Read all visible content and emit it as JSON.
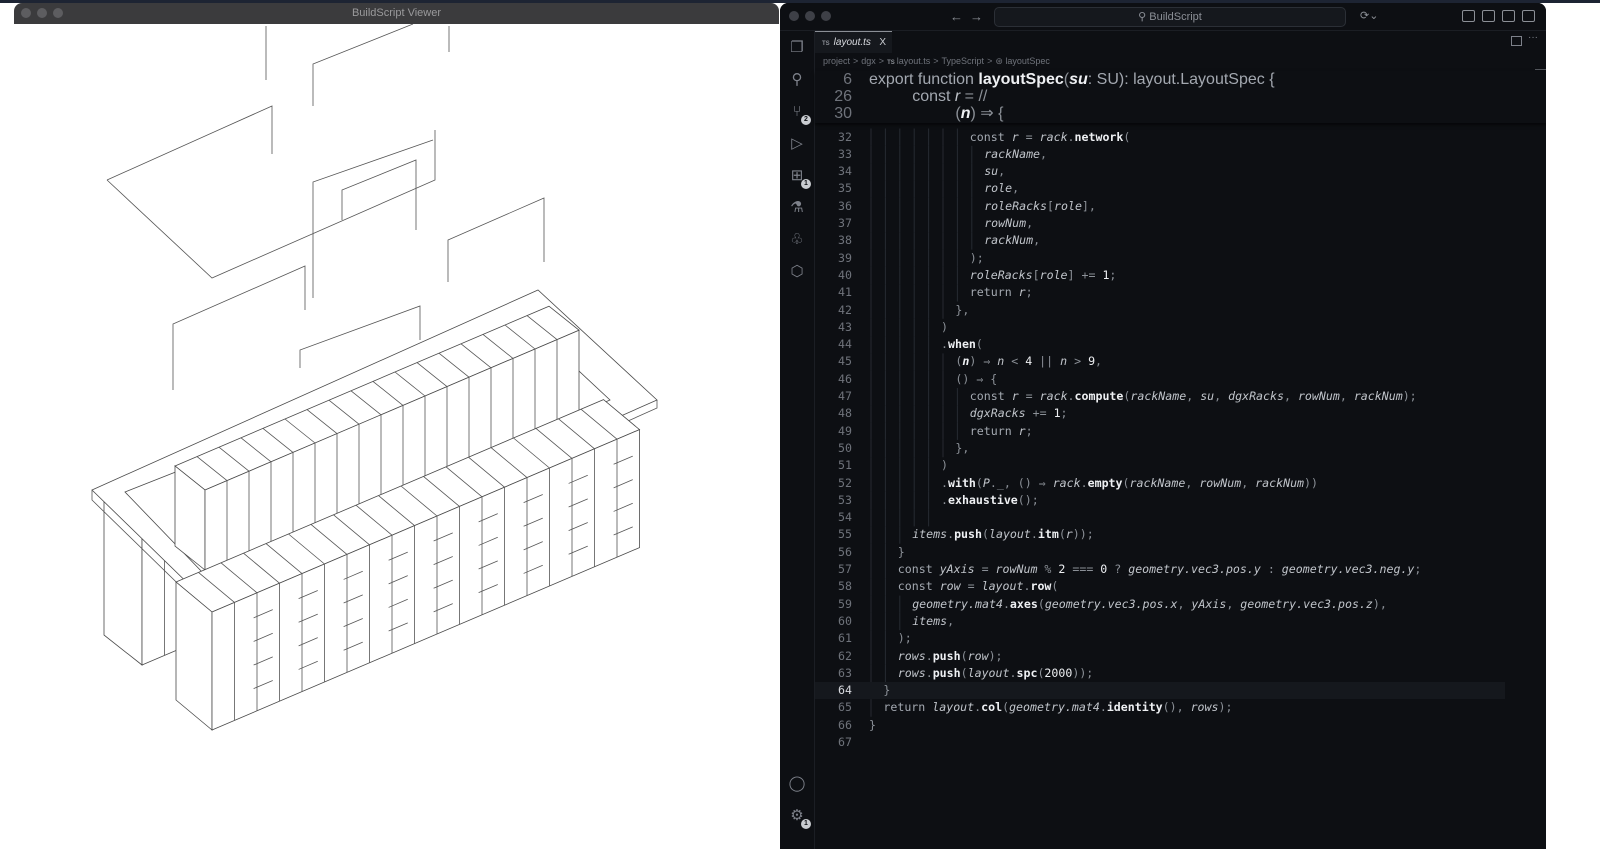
{
  "viewer": {
    "title": "BuildScript Viewer"
  },
  "editor": {
    "search": "BuildScript",
    "nav_back": "←",
    "nav_forward": "→",
    "tab": {
      "lang": "TS",
      "name": "layout.ts",
      "close": "X"
    },
    "more": "···",
    "breadcrumbs": [
      "project",
      "dgx",
      "layout.ts",
      "TypeScript",
      "layoutSpec"
    ],
    "breadcrumb_sep": ">",
    "activity_badges": {
      "source_control": "2",
      "extensions": "1",
      "settings": "1"
    }
  },
  "sticky": [
    {
      "n": "6",
      "indent": 0,
      "tokens": [
        [
          "export function ",
          "k"
        ],
        [
          "layoutSpec",
          "f"
        ],
        [
          "(",
          "p"
        ],
        [
          "su",
          "vb"
        ],
        [
          ": SU): layout.LayoutSpec {",
          "k"
        ]
      ]
    },
    {
      "n": "26",
      "indent": 6,
      "tokens": [
        [
          "const ",
          "k"
        ],
        [
          "r",
          "v"
        ],
        [
          " = //",
          "p"
        ]
      ]
    },
    {
      "n": "30",
      "indent": 12,
      "tokens": [
        [
          "(",
          "p"
        ],
        [
          "n",
          "vb"
        ],
        [
          ") ⇒ {",
          "p"
        ]
      ]
    }
  ],
  "code": {
    "current_line": "64",
    "lines": [
      {
        "n": "32",
        "indent": 14,
        "tokens": [
          [
            "const ",
            "k"
          ],
          [
            "r",
            "v"
          ],
          [
            " = ",
            "p"
          ],
          [
            "rack",
            "v"
          ],
          [
            ".",
            "p"
          ],
          [
            "network",
            "f"
          ],
          [
            "(",
            "p"
          ]
        ]
      },
      {
        "n": "33",
        "indent": 16,
        "tokens": [
          [
            "rackName",
            "v"
          ],
          [
            ",",
            "p"
          ]
        ]
      },
      {
        "n": "34",
        "indent": 16,
        "tokens": [
          [
            "su",
            "v"
          ],
          [
            ",",
            "p"
          ]
        ]
      },
      {
        "n": "35",
        "indent": 16,
        "tokens": [
          [
            "role",
            "v"
          ],
          [
            ",",
            "p"
          ]
        ]
      },
      {
        "n": "36",
        "indent": 16,
        "tokens": [
          [
            "roleRacks",
            "v"
          ],
          [
            "[",
            "p"
          ],
          [
            "role",
            "v"
          ],
          [
            "],",
            "p"
          ]
        ]
      },
      {
        "n": "37",
        "indent": 16,
        "tokens": [
          [
            "rowNum",
            "v"
          ],
          [
            ",",
            "p"
          ]
        ]
      },
      {
        "n": "38",
        "indent": 16,
        "tokens": [
          [
            "rackNum",
            "v"
          ],
          [
            ",",
            "p"
          ]
        ]
      },
      {
        "n": "39",
        "indent": 14,
        "tokens": [
          [
            ");",
            "p"
          ]
        ]
      },
      {
        "n": "40",
        "indent": 14,
        "tokens": [
          [
            "roleRacks",
            "v"
          ],
          [
            "[",
            "p"
          ],
          [
            "role",
            "v"
          ],
          [
            "] += ",
            "p"
          ],
          [
            "1",
            "n"
          ],
          [
            ";",
            "p"
          ]
        ]
      },
      {
        "n": "41",
        "indent": 14,
        "tokens": [
          [
            "return ",
            "k"
          ],
          [
            "r",
            "v"
          ],
          [
            ";",
            "p"
          ]
        ]
      },
      {
        "n": "42",
        "indent": 12,
        "tokens": [
          [
            "},",
            "p"
          ]
        ]
      },
      {
        "n": "43",
        "indent": 10,
        "tokens": [
          [
            ")",
            "p"
          ]
        ]
      },
      {
        "n": "44",
        "indent": 10,
        "tokens": [
          [
            ".",
            "p"
          ],
          [
            "when",
            "f"
          ],
          [
            "(",
            "p"
          ]
        ]
      },
      {
        "n": "45",
        "indent": 12,
        "tokens": [
          [
            "(",
            "p"
          ],
          [
            "n",
            "vb"
          ],
          [
            ") ⇒ ",
            "p"
          ],
          [
            "n",
            "v"
          ],
          [
            " < ",
            "p"
          ],
          [
            "4",
            "n"
          ],
          [
            " || ",
            "p"
          ],
          [
            "n",
            "v"
          ],
          [
            " > ",
            "p"
          ],
          [
            "9",
            "n"
          ],
          [
            ",",
            "p"
          ]
        ]
      },
      {
        "n": "46",
        "indent": 12,
        "tokens": [
          [
            "() ⇒ {",
            "p"
          ]
        ]
      },
      {
        "n": "47",
        "indent": 14,
        "tokens": [
          [
            "const ",
            "k"
          ],
          [
            "r",
            "v"
          ],
          [
            " = ",
            "p"
          ],
          [
            "rack",
            "v"
          ],
          [
            ".",
            "p"
          ],
          [
            "compute",
            "f"
          ],
          [
            "(",
            "p"
          ],
          [
            "rackName",
            "v"
          ],
          [
            ", ",
            "p"
          ],
          [
            "su",
            "v"
          ],
          [
            ", ",
            "p"
          ],
          [
            "dgxRacks",
            "v"
          ],
          [
            ", ",
            "p"
          ],
          [
            "rowNum",
            "v"
          ],
          [
            ", ",
            "p"
          ],
          [
            "rackNum",
            "v"
          ],
          [
            ");",
            "p"
          ]
        ]
      },
      {
        "n": "48",
        "indent": 14,
        "tokens": [
          [
            "dgxRacks",
            "v"
          ],
          [
            " += ",
            "p"
          ],
          [
            "1",
            "n"
          ],
          [
            ";",
            "p"
          ]
        ]
      },
      {
        "n": "49",
        "indent": 14,
        "tokens": [
          [
            "return ",
            "k"
          ],
          [
            "r",
            "v"
          ],
          [
            ";",
            "p"
          ]
        ]
      },
      {
        "n": "50",
        "indent": 12,
        "tokens": [
          [
            "},",
            "p"
          ]
        ]
      },
      {
        "n": "51",
        "indent": 10,
        "tokens": [
          [
            ")",
            "p"
          ]
        ]
      },
      {
        "n": "52",
        "indent": 10,
        "tokens": [
          [
            ".",
            "p"
          ],
          [
            "with",
            "f"
          ],
          [
            "(",
            "p"
          ],
          [
            "P",
            "v"
          ],
          [
            "._, () ⇒ ",
            "p"
          ],
          [
            "rack",
            "v"
          ],
          [
            ".",
            "p"
          ],
          [
            "empty",
            "f"
          ],
          [
            "(",
            "p"
          ],
          [
            "rackName",
            "v"
          ],
          [
            ", ",
            "p"
          ],
          [
            "rowNum",
            "v"
          ],
          [
            ", ",
            "p"
          ],
          [
            "rackNum",
            "v"
          ],
          [
            "))",
            "p"
          ]
        ]
      },
      {
        "n": "53",
        "indent": 10,
        "tokens": [
          [
            ".",
            "p"
          ],
          [
            "exhaustive",
            "f"
          ],
          [
            "();",
            "p"
          ]
        ]
      },
      {
        "n": "54",
        "indent": 0,
        "tokens": []
      },
      {
        "n": "55",
        "indent": 6,
        "tokens": [
          [
            "items",
            "v"
          ],
          [
            ".",
            "p"
          ],
          [
            "push",
            "f"
          ],
          [
            "(",
            "p"
          ],
          [
            "layout",
            "v"
          ],
          [
            ".",
            "p"
          ],
          [
            "itm",
            "f"
          ],
          [
            "(",
            "p"
          ],
          [
            "r",
            "v"
          ],
          [
            "));",
            "p"
          ]
        ]
      },
      {
        "n": "56",
        "indent": 4,
        "tokens": [
          [
            "}",
            "p"
          ]
        ]
      },
      {
        "n": "57",
        "indent": 4,
        "tokens": [
          [
            "const ",
            "k"
          ],
          [
            "yAxis",
            "v"
          ],
          [
            " = ",
            "p"
          ],
          [
            "rowNum",
            "v"
          ],
          [
            " % ",
            "p"
          ],
          [
            "2",
            "n"
          ],
          [
            " === ",
            "p"
          ],
          [
            "0",
            "n"
          ],
          [
            " ? ",
            "p"
          ],
          [
            "geometry.vec3.pos.y",
            "v"
          ],
          [
            " : ",
            "p"
          ],
          [
            "geometry.vec3.neg.y",
            "v"
          ],
          [
            ";",
            "p"
          ]
        ]
      },
      {
        "n": "58",
        "indent": 4,
        "tokens": [
          [
            "const ",
            "k"
          ],
          [
            "row",
            "v"
          ],
          [
            " = ",
            "p"
          ],
          [
            "layout",
            "v"
          ],
          [
            ".",
            "p"
          ],
          [
            "row",
            "f"
          ],
          [
            "(",
            "p"
          ]
        ]
      },
      {
        "n": "59",
        "indent": 6,
        "tokens": [
          [
            "geometry.mat4",
            "v"
          ],
          [
            ".",
            "p"
          ],
          [
            "axes",
            "f"
          ],
          [
            "(",
            "p"
          ],
          [
            "geometry.vec3.pos.x",
            "v"
          ],
          [
            ", ",
            "p"
          ],
          [
            "yAxis",
            "v"
          ],
          [
            ", ",
            "p"
          ],
          [
            "geometry.vec3.pos.z",
            "v"
          ],
          [
            "),",
            "p"
          ]
        ]
      },
      {
        "n": "60",
        "indent": 6,
        "tokens": [
          [
            "items",
            "v"
          ],
          [
            ",",
            "p"
          ]
        ]
      },
      {
        "n": "61",
        "indent": 4,
        "tokens": [
          [
            ");",
            "p"
          ]
        ]
      },
      {
        "n": "62",
        "indent": 4,
        "tokens": [
          [
            "rows",
            "v"
          ],
          [
            ".",
            "p"
          ],
          [
            "push",
            "f"
          ],
          [
            "(",
            "p"
          ],
          [
            "row",
            "v"
          ],
          [
            ");",
            "p"
          ]
        ]
      },
      {
        "n": "63",
        "indent": 4,
        "tokens": [
          [
            "rows",
            "v"
          ],
          [
            ".",
            "p"
          ],
          [
            "push",
            "f"
          ],
          [
            "(",
            "p"
          ],
          [
            "layout",
            "v"
          ],
          [
            ".",
            "p"
          ],
          [
            "spc",
            "f"
          ],
          [
            "(",
            "p"
          ],
          [
            "2000",
            "n"
          ],
          [
            "));",
            "p"
          ]
        ]
      },
      {
        "n": "64",
        "indent": 2,
        "tokens": [
          [
            "}",
            "p"
          ]
        ]
      },
      {
        "n": "65",
        "indent": 2,
        "tokens": [
          [
            "return ",
            "k"
          ],
          [
            "layout",
            "v"
          ],
          [
            ".",
            "p"
          ],
          [
            "col",
            "f"
          ],
          [
            "(",
            "p"
          ],
          [
            "geometry.mat4",
            "v"
          ],
          [
            ".",
            "p"
          ],
          [
            "identity",
            "f"
          ],
          [
            "(), ",
            "p"
          ],
          [
            "rows",
            "v"
          ],
          [
            ");",
            "p"
          ]
        ]
      },
      {
        "n": "66",
        "indent": 0,
        "tokens": [
          [
            "}",
            "p"
          ]
        ]
      },
      {
        "n": "67",
        "indent": 0,
        "tokens": []
      }
    ]
  }
}
